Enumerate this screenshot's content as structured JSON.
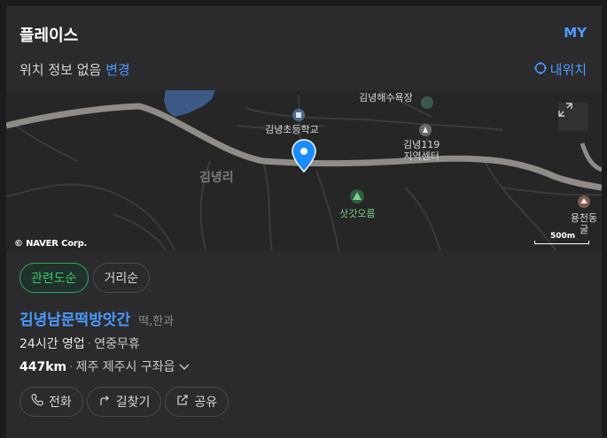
{
  "header": {
    "title": "플레이스",
    "my_label": "MY",
    "location_status": "위치 정보 없음",
    "change_label": "변경",
    "my_location_label": "내위치"
  },
  "map": {
    "copyright": "© NAVER Corp.",
    "scale_label": "500m",
    "labels": {
      "beach": "김녕해수욕장",
      "school": "김녕초등학교",
      "center_line1": "김녕119",
      "center_line2": "지역센터",
      "region": "김녕리",
      "oreum": "삿갓오름",
      "yongcheon": "용천동굴"
    }
  },
  "sort": {
    "relevance": "관련도순",
    "distance": "거리순"
  },
  "result": {
    "name": "김녕남문떡방앗간",
    "category": "떡,한과",
    "hours": "24시간 영업",
    "closed": "연중무휴",
    "distance": "447km",
    "address": "제주 제주시 구좌읍"
  },
  "actions": {
    "call": "전화",
    "directions": "길찾기",
    "share": "공유"
  },
  "colors": {
    "accent_blue": "#4c9bff",
    "accent_green": "#37c76e",
    "background": "#2b2b2d"
  },
  "icons": {
    "my_location": "crosshair-icon",
    "expand": "expand-icon",
    "pin": "map-pin-icon",
    "phone": "phone-icon",
    "directions": "turn-arrow-icon",
    "share": "share-icon",
    "chevron": "chevron-down-icon"
  }
}
